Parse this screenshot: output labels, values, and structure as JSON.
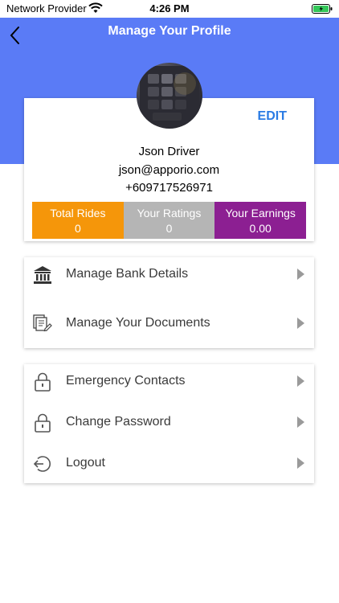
{
  "status_bar": {
    "carrier": "Network Provider",
    "time": "4:26 PM",
    "battery_color": "#34c759"
  },
  "header": {
    "title": "Manage Your Profile",
    "background_color": "#5a7bf6"
  },
  "profile": {
    "edit_label": "EDIT",
    "name": "Json Driver",
    "email": "json@apporio.com",
    "phone": "+609717526971"
  },
  "stats": [
    {
      "label": "Total Rides",
      "value": "0",
      "color": "#f5960a"
    },
    {
      "label": "Your Ratings",
      "value": "0",
      "color": "#b5b5b5"
    },
    {
      "label": "Your Earnings",
      "value": "0.00",
      "color": "#8c1f92"
    }
  ],
  "menu_group_1": [
    {
      "label": "Manage Bank Details",
      "icon": "bank-icon"
    },
    {
      "label": "Manage Your Documents",
      "icon": "documents-icon"
    }
  ],
  "menu_group_2": [
    {
      "label": "Emergency Contacts",
      "icon": "lock-icon"
    },
    {
      "label": "Change Password",
      "icon": "lock-icon"
    },
    {
      "label": "Logout",
      "icon": "logout-icon"
    }
  ]
}
